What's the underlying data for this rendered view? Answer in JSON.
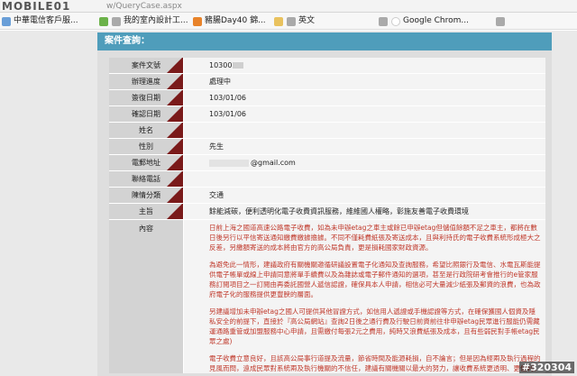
{
  "browser": {
    "watermark_logo": "MOBILE01",
    "url_fragment": "w/QueryCase.aspx"
  },
  "bookmarks": [
    {
      "label": "中華電信客戶服...",
      "icon": "chunghwa-icon"
    },
    {
      "label": "",
      "icon": "green-app-icon"
    },
    {
      "label": "我的室內設計工...",
      "icon": "gray-bookmark-icon"
    },
    {
      "label": "豬腸Day40 錦...",
      "icon": "orange-bookmark-icon"
    },
    {
      "label": "",
      "icon": "folder-icon"
    },
    {
      "label": "英文",
      "icon": "document-icon"
    },
    {
      "label": "",
      "icon": "document-icon"
    },
    {
      "label": "Google Chrom...",
      "icon": "google-icon"
    },
    {
      "label": "",
      "icon": "document-icon"
    }
  ],
  "panel": {
    "title": "案件查詢："
  },
  "form": {
    "rows": [
      {
        "label": "案件文號",
        "value": "10300"
      },
      {
        "label": "辦理進度",
        "value": "處理中"
      },
      {
        "label": "簽復日期",
        "value": "103/01/06"
      },
      {
        "label": "確認日期",
        "value": "103/01/06"
      },
      {
        "label": "姓名",
        "value": ""
      },
      {
        "label": "性別",
        "value": "先生"
      },
      {
        "label": "電郵地址",
        "value": "@gmail.com"
      },
      {
        "label": "聯絡電話",
        "value": ""
      },
      {
        "label": "陳情分類",
        "value": "交通"
      },
      {
        "label": "主旨",
        "value": "餘能減碳，便利透明化電子收費資訊服務，維維國人權略，彰施友善電子收費環境"
      }
    ],
    "content_label": "內容",
    "content_paragraphs": [
      "日前上海之國道高速公路電子收費，如為未申辦etag之車主或餘已申辦etag但儲值餘額不足之車主，都將在數日後另行以平信寄送通知繳費繳據擔據。不同不僅耗費紙張及寄送成本，且與利持氏的電子收費系統形成極大之反差，另繳額寄送的成本將由官方的高公局負責，更是損耗國家財政資源。",
      "為避免此一情形，建議政府有關機關邀循研議設置電子化通知及查詢服務，希望比照銀行及電信、水電瓦斯能提供電子帳單或線上申請同意將單手續費以及為雜誌或電子郵件通知的選項，甚至是行政院研考會推行的e管家服務訂閱項目之一訂閱由再委託國營人遞信認證，確保具本人申請，相信必可大量減少紙張及郵資的浪費，也為政府電子化的服務提供更豐腴的層面。",
      "另建議增加未申辦etag之國人可提供其他冒證方式，如信用人遞證或手機認證等方式，在確保獲國人個資及隱私安全的前提下，直接於『高公局網站』查詢2日後之通行費及行駛日前資前往非申辦etag民眾進行服能仍需藏運通路重管或加盟服務中心申請，且需繳付每張2元之費用，純時又浪費紙張及成本，且有些弱民對手帳etag民眾之處)",
      "電子收費立意良好，且該高公局事行道提及流量，節省時間及能源耗損，自不論言；但是因為經兩及執行過程的見風而問，遠成民眾對系統兩及執行機關的不信任，建議有關機關以最大的努力，讓收費系統更透明、更便利，共創更便利、科技的e化國家。"
    ]
  },
  "badge": "#320304"
}
